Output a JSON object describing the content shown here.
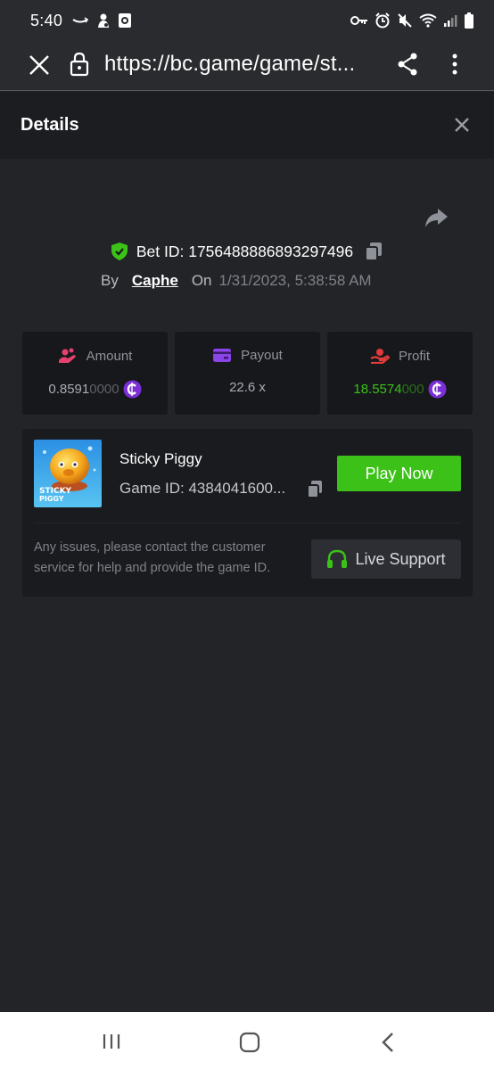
{
  "status_bar": {
    "time": "5:40",
    "left_icons": [
      "amazon-icon",
      "person-icon",
      "app-icon"
    ],
    "right_icons": [
      "key-icon",
      "alarm-icon",
      "mute-icon",
      "wifi-icon",
      "signal-icon",
      "battery-icon"
    ]
  },
  "browser": {
    "url": "https://bc.game/game/st..."
  },
  "header": {
    "title": "Details"
  },
  "bet": {
    "id_text": "Bet ID: 1756488886893297496",
    "by_label": "By",
    "user": "Caphe",
    "on_label": "On",
    "date": "1/31/2023, 5:38:58 AM"
  },
  "stats": {
    "amount": {
      "label": "Amount",
      "value_main": "0.8591",
      "value_dim": "0000"
    },
    "payout": {
      "label": "Payout",
      "value": "22.6 x"
    },
    "profit": {
      "label": "Profit",
      "value_main": "18.5574",
      "value_dim": "000"
    }
  },
  "game": {
    "name": "Sticky Piggy",
    "id_text": "Game ID: 4384041600...",
    "thumb_text_1": "STICKY",
    "thumb_text_2": "PIGGY",
    "play_label": "Play Now",
    "help_text": "Any issues, please contact the customer service for help and provide the game ID.",
    "support_label": "Live Support"
  },
  "colors": {
    "accent_green": "#3bc117",
    "background": "#232428",
    "card": "#17181c",
    "coin_purple": "#7b2fd6"
  }
}
